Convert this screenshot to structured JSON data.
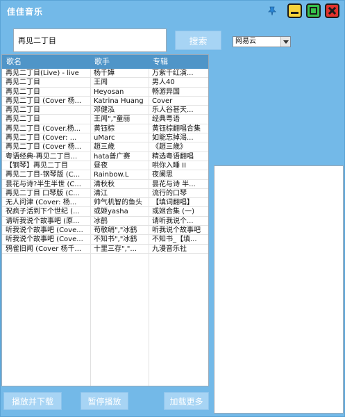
{
  "window": {
    "title": "佳佳音乐"
  },
  "search": {
    "value": "再见二丁目",
    "button_label": "搜索"
  },
  "source": {
    "selected": "网易云"
  },
  "table": {
    "headers": {
      "song": "歌名",
      "singer": "歌手",
      "album": "专辑"
    },
    "rows": [
      {
        "song": "再见二丁目(Live) - live",
        "singer": "杨千嬅",
        "album": "万紫千红演..."
      },
      {
        "song": "再见二丁目",
        "singer": "王闻",
        "album": "男人40"
      },
      {
        "song": "再见二丁目",
        "singer": "Heyosan",
        "album": "畅游异国"
      },
      {
        "song": "再见二丁目 (Cover 杨...",
        "singer": "Katrina Huang",
        "album": "Cover"
      },
      {
        "song": "再见二丁目",
        "singer": "邓健泓",
        "album": "乐人谷甚天..."
      },
      {
        "song": "再见二丁目",
        "singer": "王闻\",\"童丽",
        "album": "经典粤语"
      },
      {
        "song": "再见二丁目 (Cover.杨...",
        "singer": "黄钰棕",
        "album": "黄钰棕翻唱合集"
      },
      {
        "song": "再见二丁目 (Cover: ...",
        "singer": "uMarc",
        "album": "如能忘掉渴..."
      },
      {
        "song": "再见二丁目 (Cover 杨...",
        "singer": "趙三歳",
        "album": "《趙三歳》"
      },
      {
        "song": "粤语经典-再见二丁目...",
        "singer": "hata普广赛",
        "album": "精选粤语翻唱"
      },
      {
        "song": "【钢琴】再见二丁目",
        "singer": "昼夜",
        "album": "哄你入睡 II"
      },
      {
        "song": "再见二丁目-钢琴版 (C...",
        "singer": "Rainbow.L",
        "album": "夜阑思"
      },
      {
        "song": "昙花与诗?半生半世 (C...",
        "singer": "清秋秋",
        "album": "昙花与诗 半..."
      },
      {
        "song": "再见二丁目 口琴版 (C...",
        "singer": "清江",
        "album": "流行的口琴"
      },
      {
        "song": "无人问津 (Cover: 杨...",
        "singer": "帅气机智的鱼头",
        "album": "【填词翻唱】"
      },
      {
        "song": "祝疯子活到下个世纪 (...",
        "singer": "或姬yasha",
        "album": "或姬合集 (一)"
      },
      {
        "song": "请听我说个故事吧 (原...",
        "singer": "冰鹤",
        "album": "请听我说个..."
      },
      {
        "song": "听我说个故事吧 (Cove...",
        "singer": "苟敬绡\",\"冰鹤",
        "album": "听我说个故事吧"
      },
      {
        "song": "听我说个故事吧 (Cove...",
        "singer": "不知书\",\"冰鹤",
        "album": "不知书_【填..."
      },
      {
        "song": "鸦雀旧闻 (Cover 杨千...",
        "singer": "十里三存\",\"...",
        "album": "九漫音乐社"
      }
    ]
  },
  "buttons": {
    "play_download": "播放并下载",
    "pause": "暂停播放",
    "load_more": "加载更多"
  },
  "colors": {
    "window_bg": "#73b9e8",
    "header_bg": "#4f95c8",
    "button_bg": "#a7d4f4"
  }
}
